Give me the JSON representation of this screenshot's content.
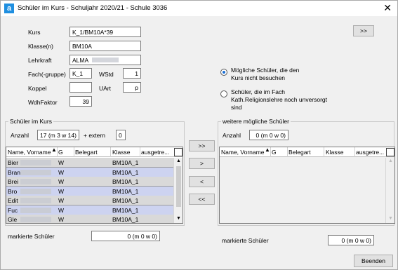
{
  "window": {
    "title": "Schüler im Kurs - Schuljahr 2020/21 - Schule 3036",
    "close_glyph": "✕",
    "app_glyph": "a"
  },
  "form": {
    "kurs_label": "Kurs",
    "kurs_value": "K_1/BM10A*39",
    "klasse_label": "Klasse(n)",
    "klasse_value": "BM10A",
    "lehrkraft_label": "Lehrkraft",
    "lehrkraft_value": "ALMA",
    "fach_label": "Fach(-gruppe)",
    "fach_value": "K_1",
    "wstd_label": "WStd",
    "wstd_value": "1",
    "koppel_label": "Koppel",
    "koppel_value": "",
    "uart_label": "UArt",
    "uart_value": "p",
    "wdh_label": "WdhFaktor",
    "wdh_value": "39"
  },
  "top_right_button": ">>",
  "options": {
    "opt1": "Mögliche Schüler, die den Kurs nicht besuchen",
    "opt2": "Schüler, die im Fach Kath.Religionslehre noch unversorgt sind"
  },
  "left_group": {
    "title": "Schüler im Kurs",
    "anzahl_label": "Anzahl",
    "anzahl_value": "17 (m 3 w 14)",
    "extern_label": "+ extern",
    "extern_value": "0",
    "columns": [
      "Name, Vorname",
      "G",
      "Belegart",
      "Klasse",
      "ausgetre..."
    ],
    "rows": [
      {
        "name": "Bier",
        "g": "W",
        "klasse": "BM10A_1",
        "selected": false
      },
      {
        "name": "Bran",
        "g": "W",
        "klasse": "BM10A_1",
        "selected": true
      },
      {
        "name": "Brei",
        "g": "W",
        "klasse": "BM10A_1",
        "selected": false
      },
      {
        "name": "Bro",
        "g": "W",
        "klasse": "BM10A_1",
        "selected": true
      },
      {
        "name": "Edit",
        "g": "W",
        "klasse": "BM10A_1",
        "selected": false
      },
      {
        "name": "Fuc",
        "g": "W",
        "klasse": "BM10A_1",
        "selected": true
      },
      {
        "name": "Gle",
        "g": "W",
        "klasse": "BM10A_1",
        "selected": false
      }
    ],
    "markiert_label": "markierte Schüler",
    "markiert_value": "0 (m 0 w 0)"
  },
  "transfer_buttons": [
    ">>",
    ">",
    "<",
    "<<"
  ],
  "right_group": {
    "title": "weitere mögliche Schüler",
    "anzahl_label": "Anzahl",
    "anzahl_value": "0 (m 0 w 0)",
    "columns": [
      "Name, Vorname",
      "G",
      "Belegart",
      "Klasse",
      "ausgetre..."
    ],
    "markiert_label": "markierte Schüler",
    "markiert_value": "0 (m 0 w 0)"
  },
  "beenden_label": "Beenden",
  "colors": {
    "selected_row": "#cdd3f0",
    "normal_row": "#d9d9d9",
    "accent": "#1a6fd6"
  }
}
